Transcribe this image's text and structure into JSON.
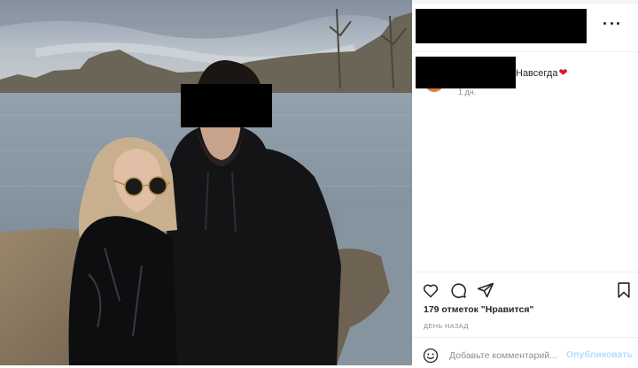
{
  "post": {
    "photo": {
      "alt_icon": "post-photo",
      "colors": {
        "sky": "#aab4bf",
        "water": "#8c9ba7",
        "shore": "#8d7a63",
        "hoodie": "#141416",
        "jacket": "#0e0e10",
        "hair": "#c8b08f"
      }
    },
    "header": {
      "more_icon": "ellipsis-icon"
    },
    "comment": {
      "text": "Навсегда",
      "emoji": "❤",
      "time": "1 дн."
    },
    "actions": {
      "like_icon": "heart-outline-icon",
      "comment_icon": "speech-bubble-icon",
      "share_icon": "paper-plane-icon",
      "save_icon": "bookmark-icon"
    },
    "likes_text": "179 отметок \"Нравится\"",
    "posted_ago": "ДЕНЬ НАЗАД",
    "add_comment": {
      "placeholder": "Добавьте комментарий...",
      "value": "",
      "submit_label": "Опубликовать",
      "emoji_icon": "smiley-icon"
    },
    "colors": {
      "accent_disabled": "#b2dffc",
      "heart": "#e0152b",
      "muted_text": "#8e8e8e"
    }
  }
}
